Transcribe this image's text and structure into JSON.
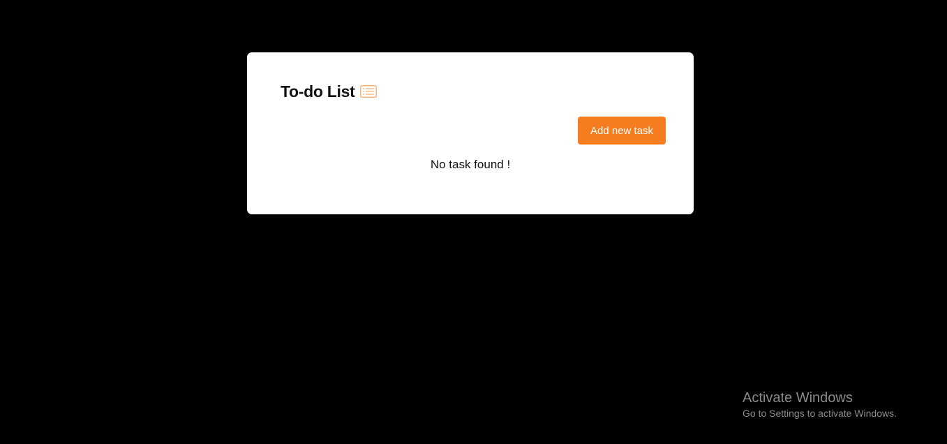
{
  "todo_card": {
    "title": "To-do List",
    "title_icon": "list-icon",
    "add_button_label": "Add new task",
    "empty_message": "No task found !"
  },
  "watermark": {
    "title": "Activate Windows",
    "subtitle": "Go to Settings to activate Windows."
  },
  "colors": {
    "background": "#000000",
    "card": "#ffffff",
    "accent": "#f57c1f"
  }
}
